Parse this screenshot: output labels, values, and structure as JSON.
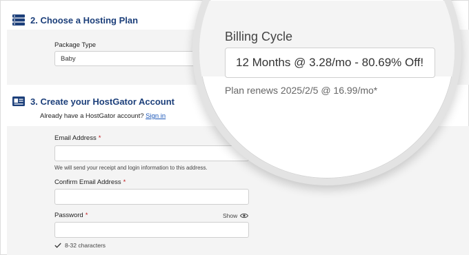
{
  "section2": {
    "title": "2. Choose a Hosting Plan"
  },
  "package": {
    "label": "Package Type",
    "value": "Baby"
  },
  "billing": {
    "label": "Billing Cycle",
    "selected": "12 Months @ 3.28/mo - 80.69% Off!",
    "renew_note": "Plan renews 2025/2/5 @ 16.99/mo*"
  },
  "section3": {
    "title": "3. Create your HostGator Account",
    "account_prompt": "Already have a HostGator account?",
    "sign_in": "Sign in"
  },
  "email": {
    "label": "Email Address",
    "required": "*",
    "help": "We will send your receipt and login information to this address."
  },
  "confirm_email": {
    "label": "Confirm Email Address",
    "required": "*"
  },
  "password": {
    "label": "Password",
    "required": "*",
    "show": "Show",
    "rule": "8-32 characters"
  },
  "colors": {
    "accent": "#1c3f7a",
    "link": "#1a56b8",
    "required": "#c0171c",
    "panel": "#f4f4f4"
  }
}
